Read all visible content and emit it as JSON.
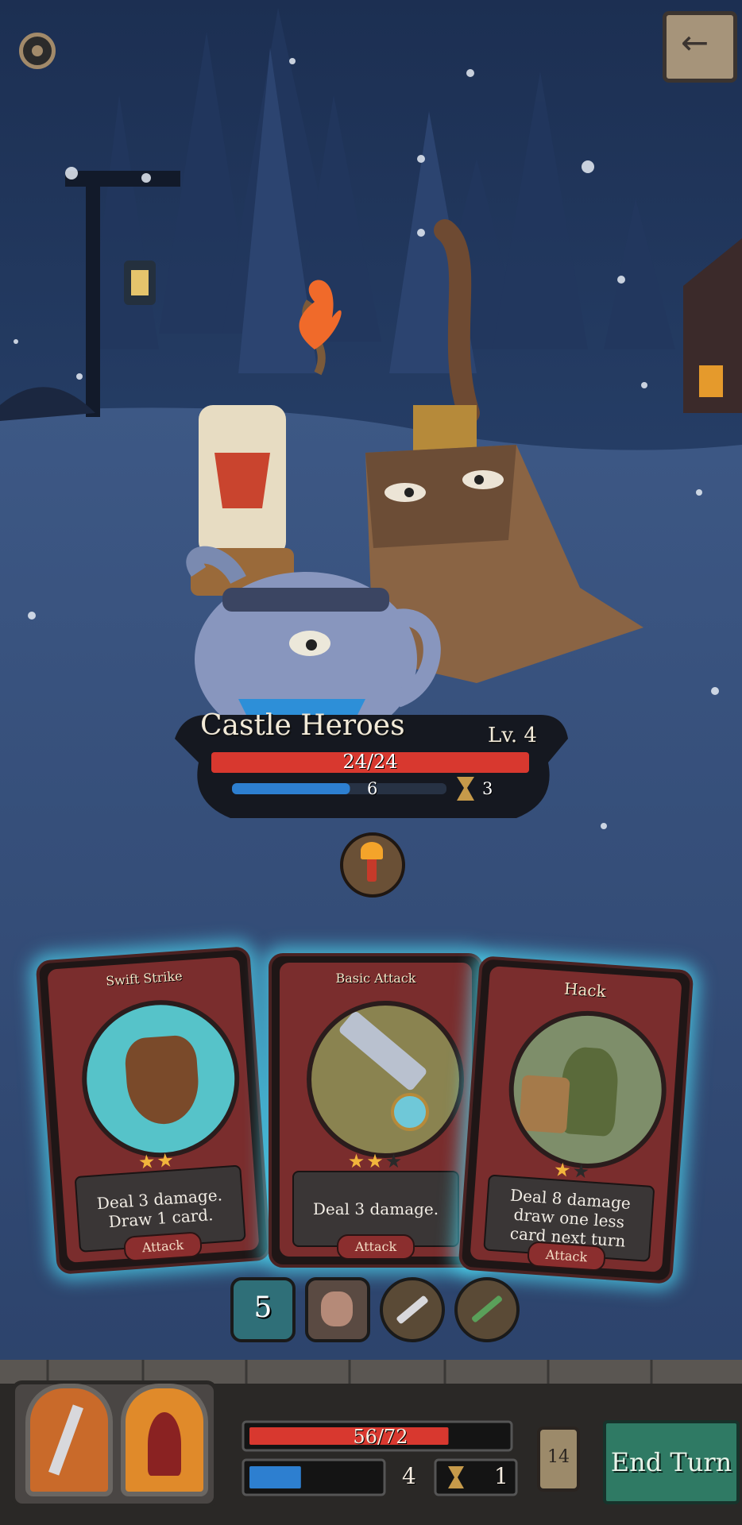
{
  "colors": {
    "sky": "#23395f",
    "snow": "#3b5585",
    "hp_red": "#d8382f",
    "shield_blue": "#2d7fd0",
    "card_glow": "#50e6ff",
    "end_turn_green": "#2f7a64"
  },
  "top_bar": {
    "settings_icon": "gear-icon",
    "back_icon": "back-arrow-icon"
  },
  "enemy": {
    "name": "Castle Heroes",
    "level": "Lv. 4",
    "hp_text": "24/24",
    "hp_fraction": 1.0,
    "shield_value": "6",
    "shield_fraction": 0.55,
    "intent_value": "3",
    "intent_icon": "hourglass-icon",
    "status_icon": "flaming-sword-icon"
  },
  "cards": [
    {
      "title": "Swift Strike",
      "desc": "Deal 3 damage. Draw 1 card.",
      "type": "Attack",
      "stars": 2,
      "max_stars": 2
    },
    {
      "title": "Basic Attack",
      "desc": "Deal 3 damage.",
      "type": "Attack",
      "stars": 2,
      "max_stars": 3
    },
    {
      "title": "Hack",
      "desc": "Deal 8 damage draw one less card next turn",
      "type": "Attack",
      "stars": 1,
      "max_stars": 2
    }
  ],
  "relics": [
    {
      "label": "5",
      "icon": "armor-counter-icon"
    },
    {
      "icon": "bandaged-arm-icon"
    },
    {
      "icon": "dagger-icon"
    },
    {
      "icon": "green-sword-icon"
    }
  ],
  "player": {
    "hp_text": "56/72",
    "hp_fraction": 0.778,
    "shield_value": "4",
    "shield_fraction": 0.4,
    "intent_value": "1",
    "deck_count": "14",
    "portraits": [
      "knight-portrait-icon",
      "hooded-mage-portrait-icon"
    ]
  },
  "end_turn_label": "End Turn"
}
